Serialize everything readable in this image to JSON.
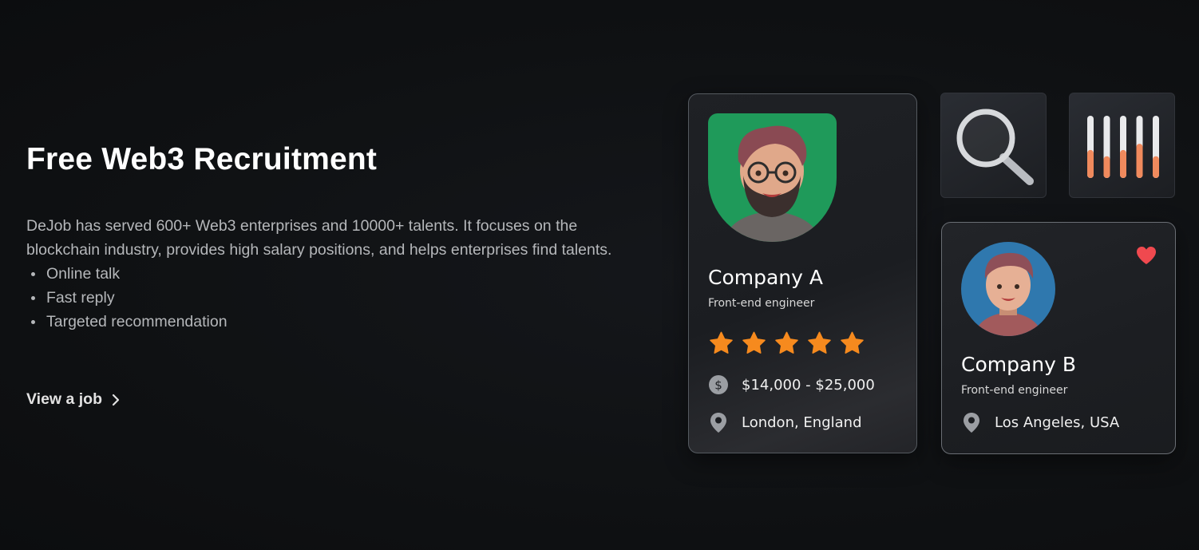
{
  "hero": {
    "title": "Free Web3 Recruitment",
    "description": "DeJob has served 600+ Web3 enterprises and 10000+ talents. It focuses on the blockchain industry, provides high salary positions, and helps enterprises find talents.",
    "features": [
      "Online talk",
      "Fast reply",
      "Targeted recommendation"
    ],
    "cta_label": "View a job"
  },
  "card_a": {
    "company": "Company A",
    "role": "Front-end engineer",
    "rating": 5,
    "salary": "$14,000 - $25,000",
    "location": "London, England",
    "avatar_bg": "#1f9a5a"
  },
  "card_b": {
    "company": "Company B",
    "role": "Front-end engineer",
    "location": "Los Angeles, USA",
    "favorited": true,
    "avatar_bg": "#2f78ae"
  },
  "icons": {
    "search_tile": "magnifier-icon",
    "chart_tile": "bar-gauge-icon",
    "star": "star-icon",
    "salary": "dollar-coin-icon",
    "location": "map-pin-icon",
    "favorite": "heart-icon"
  },
  "colors": {
    "star": "#f68a1e",
    "heart": "#f0494f",
    "bar_fill": "#f08a5d"
  },
  "chart_tile_levels": [
    0.45,
    0.35,
    0.45,
    0.55,
    0.35
  ]
}
